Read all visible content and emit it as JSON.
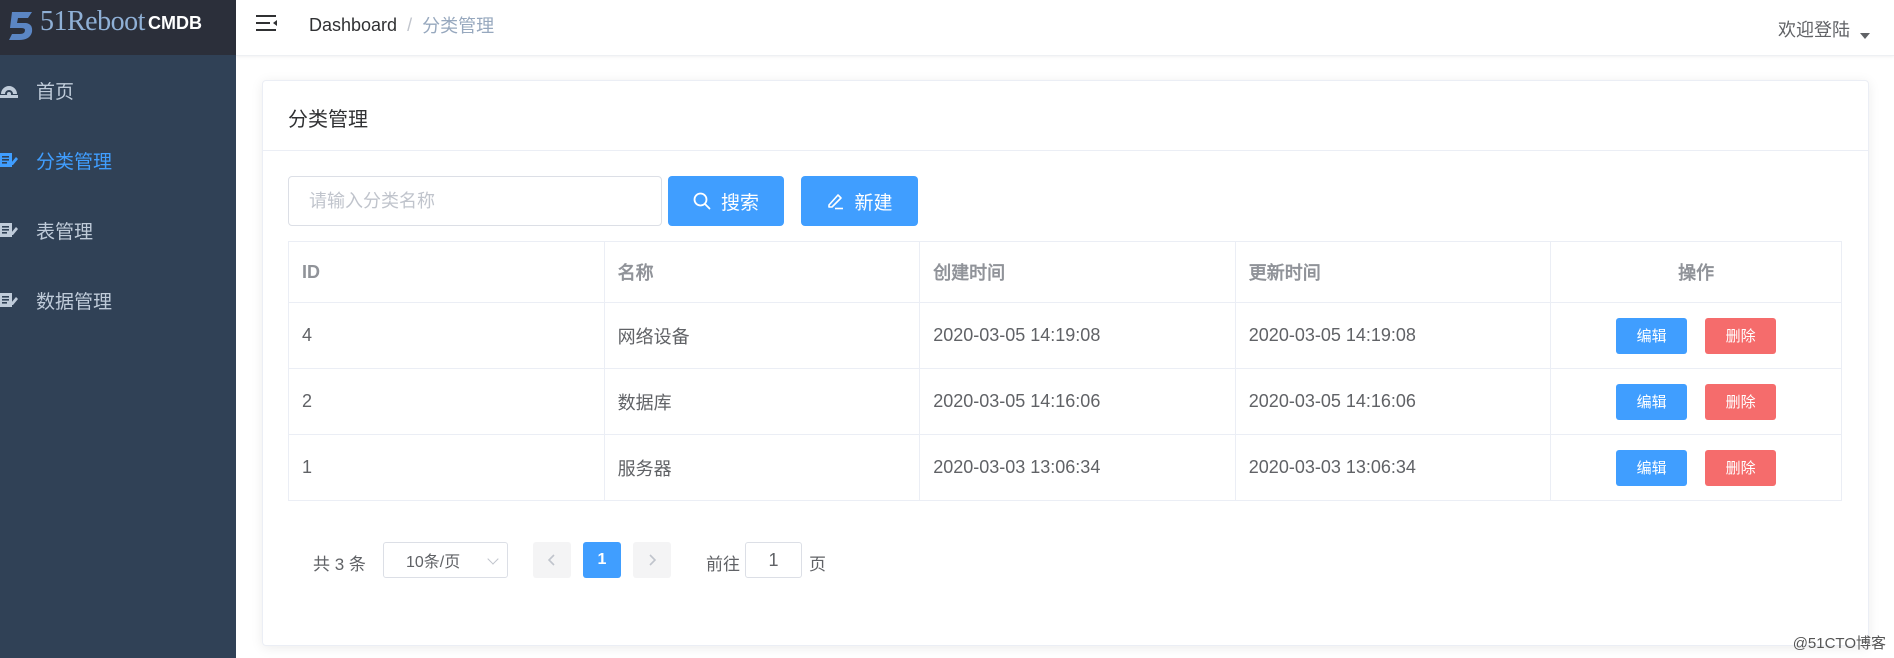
{
  "app": {
    "logo_text": "51Reboot",
    "app_name": "CMDB"
  },
  "sidebar": {
    "items": [
      {
        "label": "首页",
        "icon": "dashboard-icon"
      },
      {
        "label": "分类管理",
        "icon": "edit-doc-icon",
        "active": true
      },
      {
        "label": "表管理",
        "icon": "edit-doc-icon"
      },
      {
        "label": "数据管理",
        "icon": "edit-doc-icon"
      }
    ]
  },
  "header": {
    "breadcrumb": [
      "Dashboard",
      "分类管理"
    ],
    "breadcrumb_sep": "/",
    "user_label": "欢迎登陆"
  },
  "card": {
    "title": "分类管理"
  },
  "toolbar": {
    "search_placeholder": "请输入分类名称",
    "search_value": "",
    "search_label": "搜索",
    "new_label": "新建"
  },
  "table": {
    "columns": [
      "ID",
      "名称",
      "创建时间",
      "更新时间",
      "操作"
    ],
    "rows": [
      {
        "id": "4",
        "name": "网络设备",
        "created": "2020-03-05 14:19:08",
        "updated": "2020-03-05 14:19:08"
      },
      {
        "id": "2",
        "name": "数据库",
        "created": "2020-03-05 14:16:06",
        "updated": "2020-03-05 14:16:06"
      },
      {
        "id": "1",
        "name": "服务器",
        "created": "2020-03-03 13:06:34",
        "updated": "2020-03-03 13:06:34"
      }
    ],
    "edit_label": "编辑",
    "delete_label": "删除"
  },
  "pagination": {
    "total_text": "共 3 条",
    "page_size": "10条/页",
    "current_page": "1",
    "goto_label": "前往",
    "goto_value": "1",
    "goto_unit": "页"
  },
  "watermark": "@51CTO博客",
  "colors": {
    "primary": "#409eff",
    "danger": "#f56c6c",
    "sidebar_bg": "#304156",
    "sidebar_text": "#bfcbd9"
  }
}
